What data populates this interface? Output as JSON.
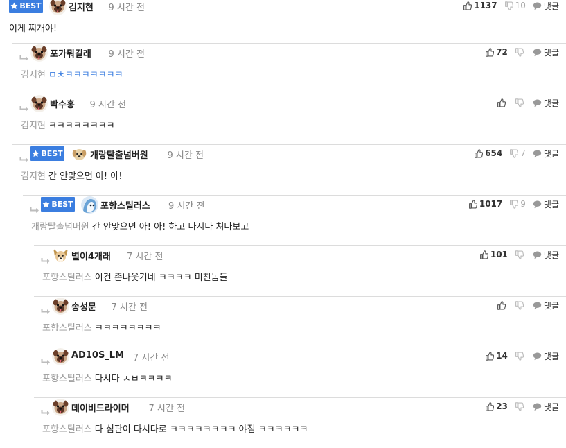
{
  "comments": [
    {
      "best": true,
      "nickname": "김지현",
      "time": "9 시간 전",
      "likes": "1137",
      "dislikes": "10",
      "reply_label": "댓글",
      "target": "",
      "text": "이게 찌개야!",
      "avatar": "pug"
    },
    {
      "best": false,
      "nickname": "포가뭐길래",
      "time": "9 시간 전",
      "likes": "72",
      "dislikes": "",
      "reply_label": "댓글",
      "target": "김지현",
      "text": "ㅁㅊㅋㅋㅋㅋㅋㅋㅋ",
      "avatar": "pug"
    },
    {
      "best": false,
      "nickname": "박수홍",
      "time": "9 시간 전",
      "likes": "",
      "dislikes": "",
      "reply_label": "댓글",
      "target": "김지현",
      "text": "ㅋㅋㅋㅋㅋㅋㅋㅋ",
      "avatar": "pug"
    },
    {
      "best": true,
      "nickname": "개랑탈출넘버원",
      "time": "9 시간 전",
      "likes": "654",
      "dislikes": "7",
      "reply_label": "댓글",
      "target": "김지현",
      "text": "간 안맞으면 아! 아!",
      "avatar": "puppy"
    },
    {
      "best": true,
      "nickname": "포항스틸러스",
      "time": "9 시간 전",
      "likes": "1017",
      "dislikes": "9",
      "reply_label": "댓글",
      "target": "개랑탈출넘버원",
      "text": "간 안맞으면 아! 아! 하고 다시다 쳐다보고",
      "avatar": "blue"
    },
    {
      "best": false,
      "nickname": "별이4개래",
      "time": "7 시간 전",
      "likes": "101",
      "dislikes": "",
      "reply_label": "댓글",
      "target": "포항스틸러스",
      "text": "이건 존나웃기네 ㅋㅋㅋㅋ 미친놈들",
      "avatar": "dog"
    },
    {
      "best": false,
      "nickname": "송성문",
      "time": "7 시간 전",
      "likes": "",
      "dislikes": "",
      "reply_label": "댓글",
      "target": "포항스틸러스",
      "text": "ㅋㅋㅋㅋㅋㅋㅋㅋ",
      "avatar": "pug"
    },
    {
      "best": false,
      "nickname": "AD10S_LM",
      "time": "7 시간 전",
      "likes": "14",
      "dislikes": "",
      "reply_label": "댓글",
      "target": "포항스틸러스",
      "text": "다시다 ㅅㅂㅋㅋㅋㅋ",
      "avatar": "pug"
    },
    {
      "best": false,
      "nickname": "데이비드라이머",
      "time": "7 시간 전",
      "likes": "23",
      "dislikes": "",
      "reply_label": "댓글",
      "target": "포항스틸러스",
      "text": "다 심판이 다시다로 ㅋㅋㅋㅋㅋㅋㅋㅋ 야점 ㅋㅋㅋㅋㅋㅋ",
      "avatar": "pug"
    }
  ],
  "colors": {
    "accent": "#3b7ee0",
    "muted": "#999999",
    "border": "#dcdcdc"
  },
  "icons": {
    "like": "thumbs-up-icon",
    "dislike": "thumbs-down-icon",
    "reply": "speech-bubble-icon",
    "reply_arrow": "reply-arrow-icon",
    "best": "star-icon"
  }
}
